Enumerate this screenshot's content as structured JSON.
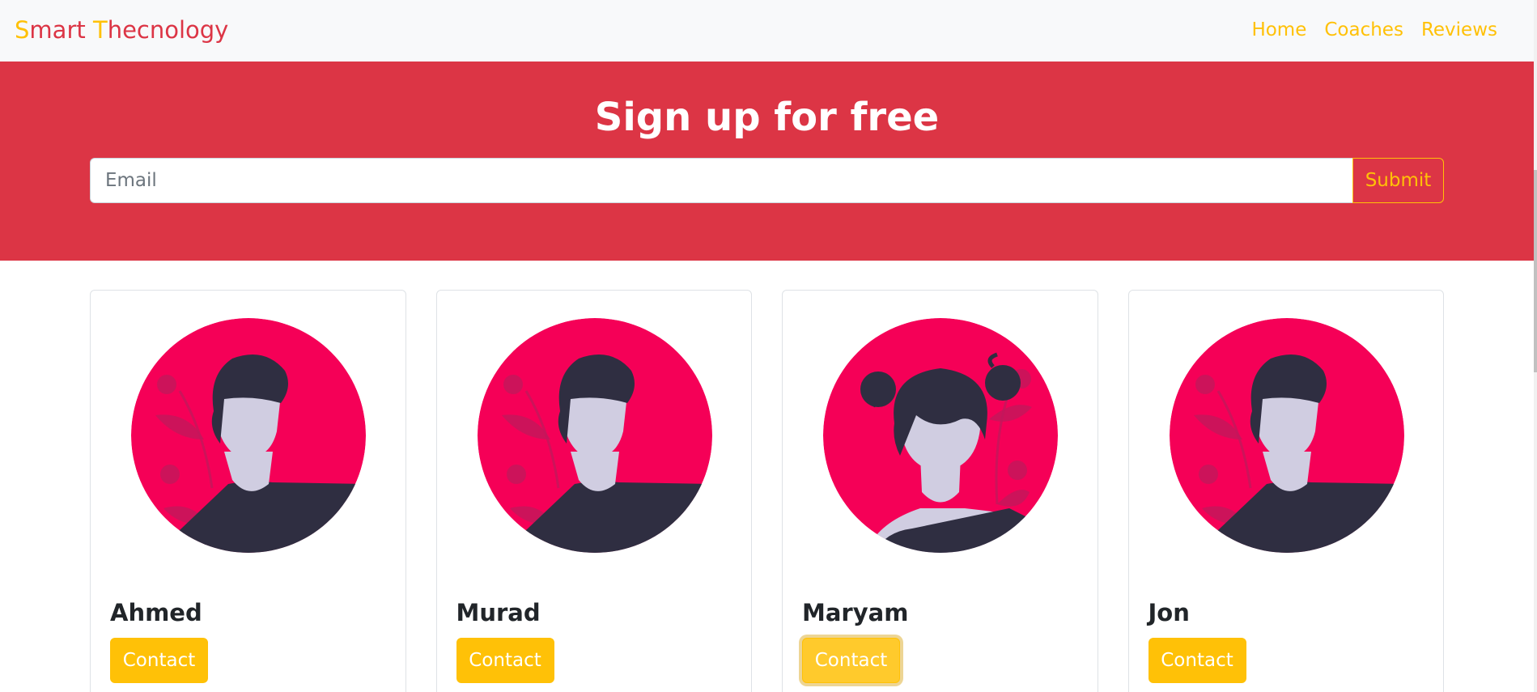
{
  "colors": {
    "primary_accent": "#ffc107",
    "danger": "#dc3545",
    "avatar_bg": "#f50057",
    "avatar_dark": "#2f2e41",
    "avatar_skin": "#d0cde1"
  },
  "navbar": {
    "brand_part1": "S",
    "brand_part2": "mart ",
    "brand_part3": "T",
    "brand_part4": "hecnology",
    "links": [
      "Home",
      "Coaches",
      "Reviews"
    ]
  },
  "hero": {
    "title": "Sign up for free",
    "email_placeholder": "Email",
    "submit_label": "Submit"
  },
  "coaches": [
    {
      "name": "Ahmed",
      "avatar": "male-avatar-icon",
      "button": "Contact",
      "focused": false
    },
    {
      "name": "Murad",
      "avatar": "male-avatar-icon",
      "button": "Contact",
      "focused": false
    },
    {
      "name": "Maryam",
      "avatar": "female-avatar-icon",
      "button": "Contact",
      "focused": true
    },
    {
      "name": "Jon",
      "avatar": "male-avatar-icon",
      "button": "Contact",
      "focused": false
    }
  ]
}
